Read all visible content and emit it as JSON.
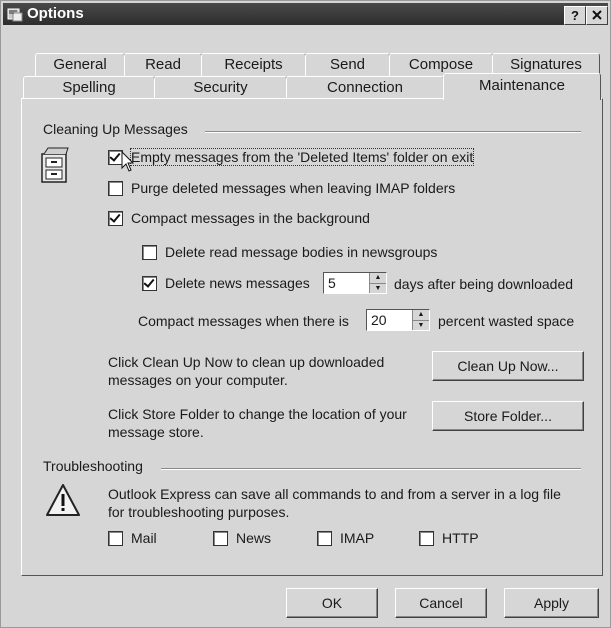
{
  "window": {
    "title": "Options",
    "help_label": "?"
  },
  "tabs": {
    "row1": [
      "General",
      "Read",
      "Receipts",
      "Send",
      "Compose",
      "Signatures"
    ],
    "row2": [
      "Spelling",
      "Security",
      "Connection",
      "Maintenance"
    ],
    "active": "Maintenance"
  },
  "cleanup": {
    "group_label": "Cleaning Up Messages",
    "empty_deleted": {
      "label": "Empty messages from the 'Deleted Items' folder on exit",
      "checked": true
    },
    "purge_imap": {
      "label": "Purge deleted messages when leaving IMAP folders",
      "checked": false
    },
    "compact_bg": {
      "label": "Compact messages in the background",
      "checked": true
    },
    "delete_read_bodies": {
      "label": "Delete read message bodies in newsgroups",
      "checked": false
    },
    "delete_news": {
      "label": "Delete news messages",
      "checked": true,
      "days_value": "5",
      "suffix": "days after being downloaded"
    },
    "compact_when": {
      "prefix": "Compact messages when there is",
      "value": "20",
      "suffix": "percent wasted space"
    },
    "cleanup_text": "Click Clean Up Now to clean up downloaded messages on your computer.",
    "cleanup_button": "Clean Up Now...",
    "store_text": "Click Store Folder to change the location of your message store.",
    "store_button": "Store Folder..."
  },
  "troubleshooting": {
    "group_label": "Troubleshooting",
    "description": "Outlook Express can save all commands to and from a server in a log file for troubleshooting purposes.",
    "options": [
      {
        "label": "Mail",
        "checked": false
      },
      {
        "label": "News",
        "checked": false
      },
      {
        "label": "IMAP",
        "checked": false
      },
      {
        "label": "HTTP",
        "checked": false
      }
    ]
  },
  "buttons": {
    "ok": "OK",
    "cancel": "Cancel",
    "apply": "Apply"
  }
}
